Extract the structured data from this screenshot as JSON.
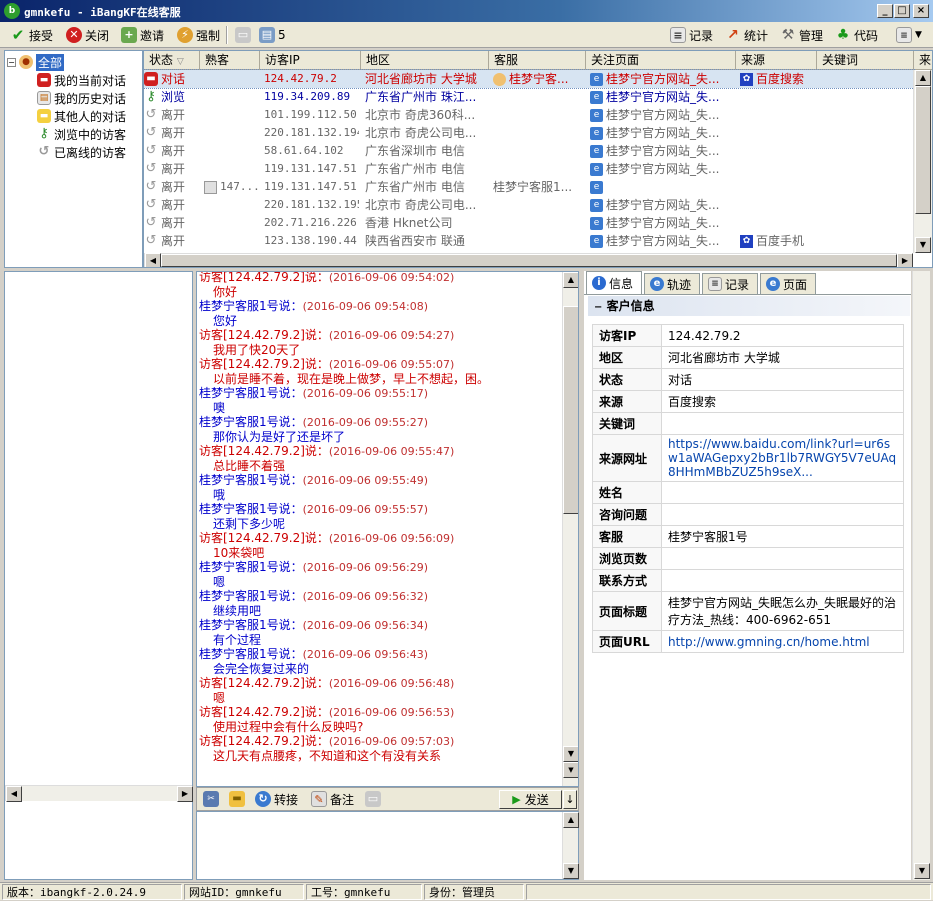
{
  "window": {
    "title": "gmnkefu - iBangKF在线客服",
    "logo": "b",
    "min_glyph": "_",
    "max_glyph": "□",
    "close_glyph": "×"
  },
  "toolbar": {
    "accept": "接受",
    "close": "关闭",
    "invite": "邀请",
    "force": "强制",
    "count": "5",
    "record": "记录",
    "stats": "统计",
    "manage": "管理",
    "code": "代码"
  },
  "tree": {
    "root": "全部",
    "items": [
      "我的当前对话",
      "我的历史对话",
      "其他人的对话",
      "浏览中的访客",
      "已离线的访客"
    ]
  },
  "grid": {
    "columns": [
      "状态",
      "熟客",
      "访客IP",
      "地区",
      "客服",
      "关注页面",
      "来源",
      "关键词",
      "来"
    ],
    "rows": [
      {
        "status": "对话",
        "regular": "",
        "ip": "124.42.79.2",
        "region": "河北省廊坊市 大学城",
        "agent": "桂梦宁客...",
        "page": "桂梦宁官方网站_失...",
        "source": "百度搜索",
        "keyword": ""
      },
      {
        "status": "浏览",
        "regular": "",
        "ip": "119.34.209.89",
        "region": "广东省广州市 珠江...",
        "agent": "",
        "page": "桂梦宁官方网站_失...",
        "source": "",
        "keyword": ""
      },
      {
        "status": "离开",
        "regular": "",
        "ip": "101.199.112.50",
        "region": "北京市 奇虎360科...",
        "agent": "",
        "page": "桂梦宁官方网站_失...",
        "source": "",
        "keyword": ""
      },
      {
        "status": "离开",
        "regular": "",
        "ip": "220.181.132.194",
        "region": "北京市 奇虎公司电...",
        "agent": "",
        "page": "桂梦宁官方网站_失...",
        "source": "",
        "keyword": ""
      },
      {
        "status": "离开",
        "regular": "",
        "ip": "58.61.64.102",
        "region": "广东省深圳市 电信",
        "agent": "",
        "page": "桂梦宁官方网站_失...",
        "source": "",
        "keyword": ""
      },
      {
        "status": "离开",
        "regular": "",
        "ip": "119.131.147.51",
        "region": "广东省广州市 电信",
        "agent": "",
        "page": "桂梦宁官方网站_失...",
        "source": "",
        "keyword": ""
      },
      {
        "status": "离开",
        "regular": "147...",
        "ip": "119.131.147.51",
        "region": "广东省广州市 电信",
        "agent": "桂梦宁客服1...",
        "page": "",
        "source": "",
        "keyword": ""
      },
      {
        "status": "离开",
        "regular": "",
        "ip": "220.181.132.195",
        "region": "北京市 奇虎公司电...",
        "agent": "",
        "page": "桂梦宁官方网站_失...",
        "source": "",
        "keyword": ""
      },
      {
        "status": "离开",
        "regular": "",
        "ip": "202.71.216.226",
        "region": "香港 Hknet公司",
        "agent": "",
        "page": "桂梦宁官方网站_失...",
        "source": "",
        "keyword": ""
      },
      {
        "status": "离开",
        "regular": "",
        "ip": "123.138.190.44",
        "region": "陕西省西安市 联通",
        "agent": "",
        "page": "桂梦宁官方网站_失...",
        "source": "百度手机",
        "keyword": ""
      }
    ]
  },
  "chat": {
    "messages": [
      {
        "who": "访客[124.42.79.2]说：",
        "time": "(2016-09-06 09:54:02)",
        "text": "你好",
        "role": "visitor"
      },
      {
        "who": "桂梦宁客服1号说：",
        "time": "(2016-09-06 09:54:08)",
        "text": "您好",
        "role": "agent"
      },
      {
        "who": "访客[124.42.79.2]说：",
        "time": "(2016-09-06 09:54:27)",
        "text": "我用了快20天了",
        "role": "visitor"
      },
      {
        "who": "访客[124.42.79.2]说：",
        "time": "(2016-09-06 09:55:07)",
        "text": "以前是睡不着，现在是晚上做梦，早上不想起，困。",
        "role": "visitor"
      },
      {
        "who": "桂梦宁客服1号说：",
        "time": "(2016-09-06 09:55:17)",
        "text": "噢",
        "role": "agent"
      },
      {
        "who": "桂梦宁客服1号说：",
        "time": "(2016-09-06 09:55:27)",
        "text": "那你认为是好了还是坏了",
        "role": "agent"
      },
      {
        "who": "访客[124.42.79.2]说：",
        "time": "(2016-09-06 09:55:47)",
        "text": "总比睡不着强",
        "role": "visitor"
      },
      {
        "who": "桂梦宁客服1号说：",
        "time": "(2016-09-06 09:55:49)",
        "text": "哦",
        "role": "agent"
      },
      {
        "who": "桂梦宁客服1号说：",
        "time": "(2016-09-06 09:55:57)",
        "text": "还剩下多少呢",
        "role": "agent"
      },
      {
        "who": "访客[124.42.79.2]说：",
        "time": "(2016-09-06 09:56:09)",
        "text": "10来袋吧",
        "role": "visitor"
      },
      {
        "who": "桂梦宁客服1号说：",
        "time": "(2016-09-06 09:56:29)",
        "text": "嗯",
        "role": "agent"
      },
      {
        "who": "桂梦宁客服1号说：",
        "time": "(2016-09-06 09:56:32)",
        "text": "继续用吧",
        "role": "agent"
      },
      {
        "who": "桂梦宁客服1号说：",
        "time": "(2016-09-06 09:56:34)",
        "text": "有个过程",
        "role": "agent"
      },
      {
        "who": "桂梦宁客服1号说：",
        "time": "(2016-09-06 09:56:43)",
        "text": "会完全恢复过来的",
        "role": "agent"
      },
      {
        "who": "访客[124.42.79.2]说：",
        "time": "(2016-09-06 09:56:48)",
        "text": "嗯",
        "role": "visitor"
      },
      {
        "who": "访客[124.42.79.2]说：",
        "time": "(2016-09-06 09:56:53)",
        "text": "使用过程中会有什么反映吗?",
        "role": "visitor"
      },
      {
        "who": "访客[124.42.79.2]说：",
        "time": "(2016-09-06 09:57:03)",
        "text": "这几天有点腰疼，不知道和这个有没有关系",
        "role": "visitor"
      }
    ]
  },
  "inputbar": {
    "transfer": "转接",
    "note": "备注",
    "send": "发送"
  },
  "info": {
    "tabs": [
      "信息",
      "轨迹",
      "记录",
      "页面"
    ],
    "section": "客户信息",
    "fields": [
      {
        "label": "访客IP",
        "value": "124.42.79.2"
      },
      {
        "label": "地区",
        "value": "河北省廊坊市 大学城"
      },
      {
        "label": "状态",
        "value": "对话"
      },
      {
        "label": "来源",
        "value": "百度搜索"
      },
      {
        "label": "关键词",
        "value": ""
      },
      {
        "label": "来源网址",
        "value": "https://www.baidu.com/link?url=ur6sw1aWAGepxy2bBr1lb7RWGY5V7eUAq8HHmMBbZUZ5h9seX..."
      },
      {
        "label": "姓名",
        "value": ""
      },
      {
        "label": "咨询问题",
        "value": ""
      },
      {
        "label": "客服",
        "value": "桂梦宁客服1号"
      },
      {
        "label": "浏览页数",
        "value": ""
      },
      {
        "label": "联系方式",
        "value": ""
      },
      {
        "label": "页面标题",
        "value": "桂梦宁官方网站_失眠怎么办_失眠最好的治疗方法_热线：400-6962-651"
      },
      {
        "label": "页面URL",
        "value": "http://www.gmning.cn/home.html"
      }
    ]
  },
  "status": {
    "version": "版本：ibangkf-2.0.24.9",
    "site": "网站ID：gmnkefu",
    "worker": "工号：gmnkefu",
    "role": "身份：管理员"
  }
}
